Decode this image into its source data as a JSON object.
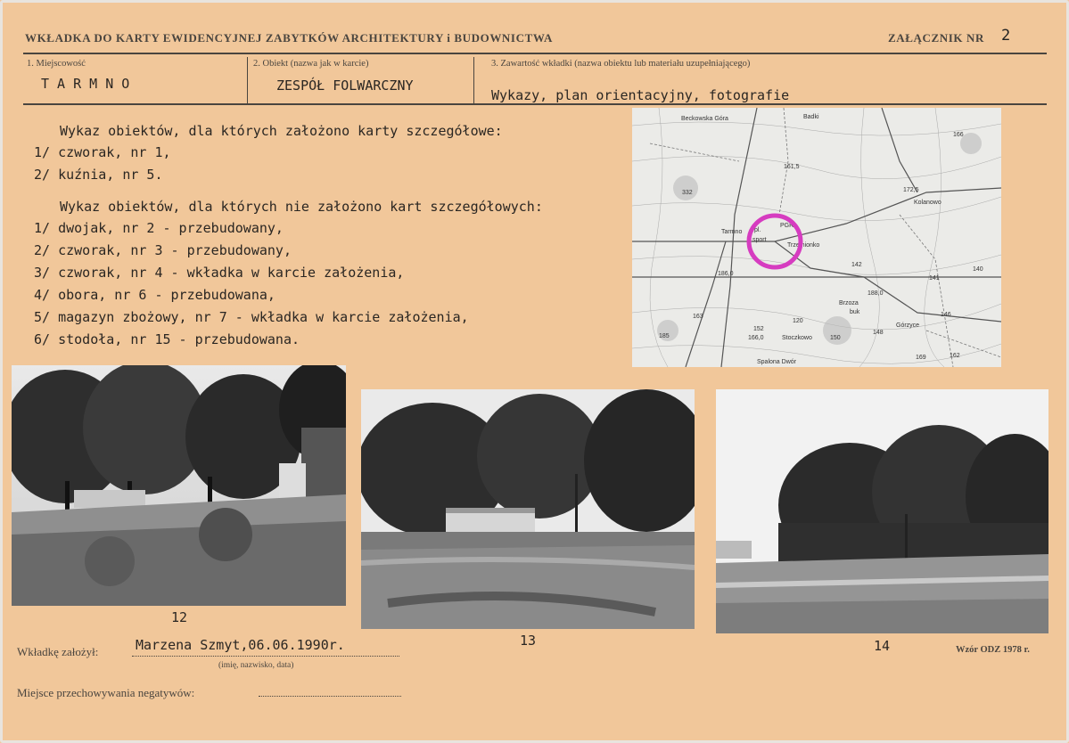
{
  "header": {
    "title": "WKŁADKA DO KARTY EWIDENCYJNEJ ZABYTKÓW ARCHITEKTURY i BUDOWNICTWA",
    "annex_label": "ZAŁĄCZNIK NR",
    "annex_number": "2"
  },
  "fields": {
    "locality_label": "1. Miejscowość",
    "locality_value": "T A R M N O",
    "object_label": "2. Obiekt (nazwa jak w karcie)",
    "object_value": "ZESPÓŁ FOLWARCZNY",
    "contents_label": "3. Zawartość wkładki (nazwa obiektu lub materiału uzupełniającego)",
    "contents_value": "Wykazy, plan orientacyjny, fotografie"
  },
  "list_with_cards": {
    "heading": "Wykaz obiektów, dla których założono karty szczegółowe:",
    "items": [
      "1/ czworak, nr 1,",
      "2/ kuźnia, nr 5."
    ]
  },
  "list_without_cards": {
    "heading": "Wykaz obiektów, dla których nie założono kart szczegółowych:",
    "items": [
      "1/ dwojak, nr 2 - przebudowany,",
      "2/ czworak, nr 3 - przebudowany,",
      "3/ czworak, nr 4 - wkładka w karcie założenia,",
      "4/ obora, nr 6 - przebudowana,",
      "5/ magazyn zbożowy, nr 7 - wkładka w karcie założenia,",
      "6/ stodoła, nr 15 - przebudowana."
    ]
  },
  "map": {
    "labels": [
      "Beckowska Góra",
      "Badki",
      "161,5",
      "172,5",
      "166",
      "332",
      "Kolanowo",
      "Tarmno",
      "pl.",
      "PGR",
      "sport",
      "Trzemionko",
      "186,0",
      "142",
      "141",
      "140",
      "188,0",
      "Brzoza",
      "buk",
      "163",
      "120",
      "152",
      "Górzyce",
      "146",
      "185",
      "166,0",
      "Stoczkowo",
      "150",
      "148",
      "Spalona Dwór",
      "162",
      "169"
    ],
    "marker_color": "#d63cc0"
  },
  "photos": {
    "captions": [
      "12",
      "13",
      "14"
    ]
  },
  "footer": {
    "founder_label": "Wkładkę założył:",
    "founder_value": "Marzena Szmyt,06.06.1990r.",
    "founder_hint": "(imię, nazwisko, data)",
    "negatives_label": "Miejsce przechowywania negatywów:",
    "form_label": "Wzór ODZ",
    "form_year": "1978 r."
  }
}
